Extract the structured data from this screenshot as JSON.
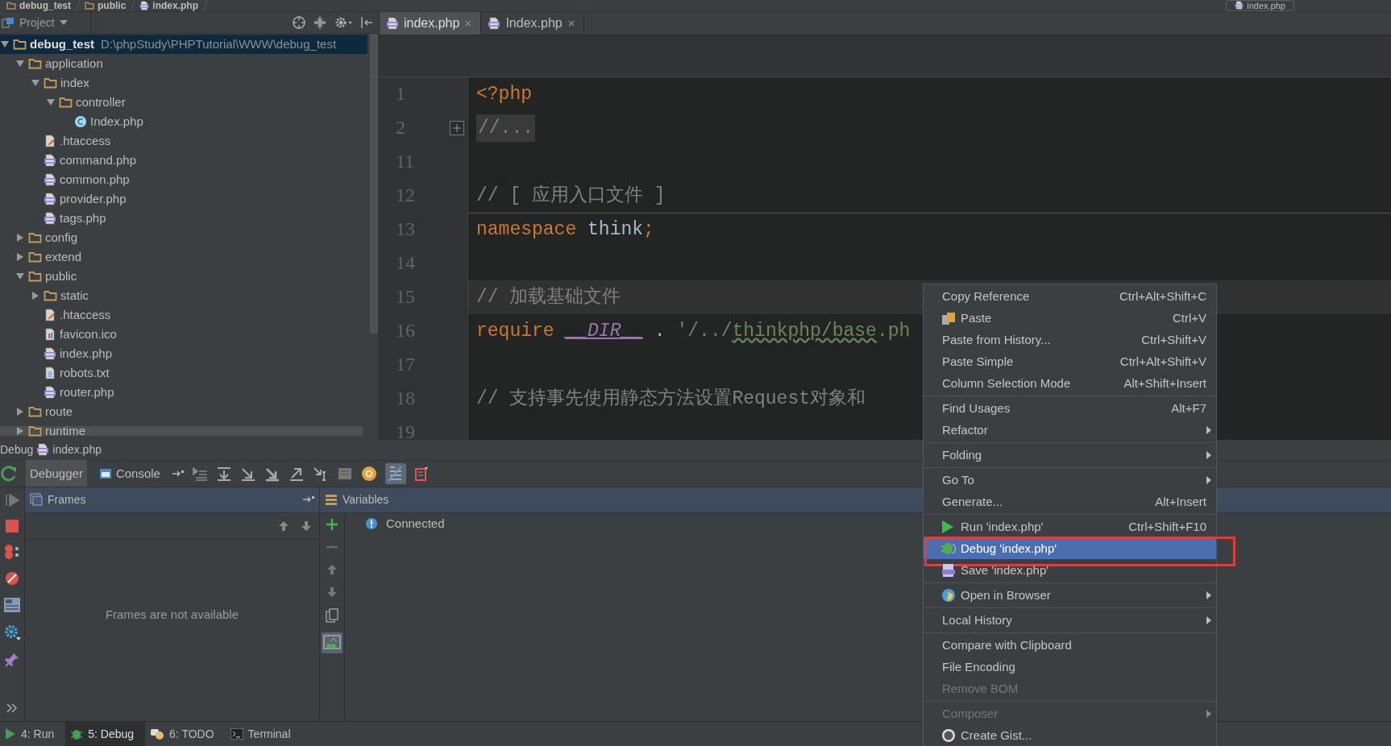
{
  "breadcrumb": [
    {
      "label": "debug_test",
      "kind": "folder"
    },
    {
      "label": "public",
      "kind": "folder"
    },
    {
      "label": "index.php",
      "kind": "php"
    }
  ],
  "run_config": "index.php",
  "project": {
    "title": "Project",
    "tree": [
      {
        "name": "debug_test",
        "path": "D:\\phpStudy\\PHPTutorial\\WWW\\debug_test",
        "kind": "folder",
        "expanded": true,
        "selected": true,
        "children": [
          {
            "name": "application",
            "kind": "folder",
            "expanded": true,
            "selected": false,
            "children": [
              {
                "name": "index",
                "kind": "folder",
                "expanded": true,
                "selected": false,
                "children": [
                  {
                    "name": "controller",
                    "kind": "folder",
                    "expanded": true,
                    "selected": false,
                    "children": [
                      {
                        "name": "Index.php",
                        "kind": "class",
                        "selected": false
                      }
                    ]
                  }
                ]
              },
              {
                "name": ".htaccess",
                "kind": "htaccess",
                "selected": false
              },
              {
                "name": "command.php",
                "kind": "php",
                "selected": false
              },
              {
                "name": "common.php",
                "kind": "php",
                "selected": false
              },
              {
                "name": "provider.php",
                "kind": "php",
                "selected": false
              },
              {
                "name": "tags.php",
                "kind": "php",
                "selected": false
              }
            ]
          },
          {
            "name": "config",
            "kind": "folder",
            "expanded": false,
            "selected": false
          },
          {
            "name": "extend",
            "kind": "folder",
            "expanded": false,
            "selected": false
          },
          {
            "name": "public",
            "kind": "folder",
            "expanded": true,
            "selected": false,
            "children": [
              {
                "name": "static",
                "kind": "folder",
                "expanded": false,
                "selected": false
              },
              {
                "name": ".htaccess",
                "kind": "htaccess",
                "selected": false
              },
              {
                "name": "favicon.ico",
                "kind": "ico",
                "selected": false
              },
              {
                "name": "index.php",
                "kind": "php",
                "selected": false
              },
              {
                "name": "robots.txt",
                "kind": "txt",
                "selected": false
              },
              {
                "name": "router.php",
                "kind": "php",
                "selected": false
              }
            ]
          },
          {
            "name": "route",
            "kind": "folder",
            "expanded": false,
            "selected": false
          },
          {
            "name": "runtime",
            "kind": "folder",
            "expanded": false,
            "selected": false
          }
        ]
      }
    ]
  },
  "editor": {
    "tabs": [
      {
        "label": "index.php",
        "selected": true
      },
      {
        "label": "Index.php",
        "selected": false
      }
    ],
    "lines": [
      {
        "number": "1",
        "current": false,
        "folded": false,
        "separator_above": false,
        "tokens": [
          {
            "text": "<?php",
            "kind": "keyword"
          }
        ]
      },
      {
        "number": "2",
        "current": false,
        "folded": true,
        "separator_above": false,
        "tokens": [
          {
            "text": "//...",
            "kind": "folded"
          }
        ]
      },
      {
        "number": "11",
        "current": false,
        "folded": false,
        "separator_above": false
      },
      {
        "number": "12",
        "current": false,
        "folded": false,
        "separator_above": false,
        "tokens": [
          {
            "text": "// [ 应用入口文件 ]",
            "kind": "comment"
          }
        ]
      },
      {
        "number": "13",
        "current": false,
        "folded": false,
        "separator_above": true,
        "tokens": [
          {
            "text": "namespace",
            "kind": "keyword"
          },
          {
            "text": " think",
            "kind": "plain"
          },
          {
            "text": ";",
            "kind": "keyword"
          }
        ]
      },
      {
        "number": "14",
        "current": false,
        "folded": false,
        "separator_above": false
      },
      {
        "number": "15",
        "current": true,
        "folded": false,
        "separator_above": false,
        "tokens": [
          {
            "text": "// 加载基础文件",
            "kind": "comment"
          }
        ]
      },
      {
        "number": "16",
        "current": false,
        "folded": false,
        "separator_above": false,
        "tokens": [
          {
            "text": "require ",
            "kind": "keyword"
          },
          {
            "text": "__DIR__",
            "kind": "constant"
          },
          {
            "text": " . ",
            "kind": "plain"
          },
          {
            "text": "'/../",
            "kind": "string"
          },
          {
            "text": "thinkphp/base",
            "kind": "typo"
          },
          {
            "text": ".ph",
            "kind": "string"
          }
        ]
      },
      {
        "number": "17",
        "current": false,
        "folded": false,
        "separator_above": false
      },
      {
        "number": "18",
        "current": false,
        "folded": false,
        "separator_above": false,
        "tokens": [
          {
            "text": "// 支持事先使用静态方法设置Request对象和",
            "kind": "comment"
          }
        ]
      },
      {
        "number": "19",
        "current": false,
        "folded": false,
        "separator_above": false
      }
    ]
  },
  "debug": {
    "title": "Debug",
    "file": "index.php",
    "tabs": [
      {
        "label": "Debugger",
        "selected": true
      },
      {
        "label": "Console",
        "selected": false
      }
    ],
    "show_values_on": true,
    "frames": {
      "title": "Frames",
      "empty_text": "Frames are not available"
    },
    "variables": {
      "title": "Variables",
      "inline_watches_on": true,
      "items": [
        {
          "text": "Connected",
          "kind": "info"
        }
      ]
    }
  },
  "tool_windows": [
    {
      "label": "4: Run",
      "kind": "run",
      "selected": false
    },
    {
      "label": "5: Debug",
      "kind": "debug",
      "selected": true
    },
    {
      "label": "6: TODO",
      "kind": "todo",
      "selected": false
    },
    {
      "label": "Terminal",
      "kind": "terminal",
      "selected": false
    }
  ],
  "context_menu": {
    "items": [
      {
        "kind": "plain",
        "label": "Copy Reference",
        "shortcut": "Ctrl+Alt+Shift+C",
        "submenu": false,
        "disabled": false,
        "selected": false,
        "annotated": false
      },
      {
        "kind": "paste",
        "label": "Paste",
        "shortcut": "Ctrl+V",
        "submenu": false,
        "disabled": false,
        "selected": false,
        "annotated": false
      },
      {
        "kind": "plain",
        "label": "Paste from History...",
        "shortcut": "Ctrl+Shift+V",
        "submenu": false,
        "disabled": false,
        "selected": false,
        "annotated": false
      },
      {
        "kind": "plain",
        "label": "Paste Simple",
        "shortcut": "Ctrl+Alt+Shift+V",
        "submenu": false,
        "disabled": false,
        "selected": false,
        "annotated": false
      },
      {
        "kind": "plain",
        "label": "Column Selection Mode",
        "shortcut": "Alt+Shift+Insert",
        "submenu": false,
        "disabled": false,
        "selected": false,
        "annotated": false
      },
      {
        "kind": "separator"
      },
      {
        "kind": "plain",
        "label": "Find Usages",
        "shortcut": "Alt+F7",
        "submenu": false,
        "disabled": false,
        "selected": false,
        "annotated": false
      },
      {
        "kind": "plain",
        "label": "Refactor",
        "submenu": true,
        "disabled": false,
        "selected": false,
        "annotated": false
      },
      {
        "kind": "separator"
      },
      {
        "kind": "plain",
        "label": "Folding",
        "submenu": true,
        "disabled": false,
        "selected": false,
        "annotated": false
      },
      {
        "kind": "separator"
      },
      {
        "kind": "plain",
        "label": "Go To",
        "submenu": true,
        "disabled": false,
        "selected": false,
        "annotated": false
      },
      {
        "kind": "plain",
        "label": "Generate...",
        "shortcut": "Alt+Insert",
        "submenu": false,
        "disabled": false,
        "selected": false,
        "annotated": false
      },
      {
        "kind": "separator"
      },
      {
        "kind": "run",
        "label": "Run 'index.php'",
        "shortcut": "Ctrl+Shift+F10",
        "submenu": false,
        "disabled": false,
        "selected": false,
        "annotated": false
      },
      {
        "kind": "debug",
        "label": "Debug 'index.php'",
        "submenu": false,
        "disabled": false,
        "selected": true,
        "annotated": true
      },
      {
        "kind": "save",
        "label": "Save 'index.php'",
        "submenu": false,
        "disabled": false,
        "selected": false,
        "annotated": false
      },
      {
        "kind": "separator"
      },
      {
        "kind": "browser",
        "label": "Open in Browser",
        "submenu": true,
        "disabled": false,
        "selected": false,
        "annotated": false
      },
      {
        "kind": "separator"
      },
      {
        "kind": "plain",
        "label": "Local History",
        "submenu": true,
        "disabled": false,
        "selected": false,
        "annotated": false
      },
      {
        "kind": "separator"
      },
      {
        "kind": "plain",
        "label": "Compare with Clipboard",
        "submenu": false,
        "disabled": false,
        "selected": false,
        "annotated": false
      },
      {
        "kind": "plain",
        "label": "File Encoding",
        "submenu": false,
        "disabled": false,
        "selected": false,
        "annotated": false
      },
      {
        "kind": "plain",
        "label": "Remove BOM",
        "submenu": false,
        "disabled": true,
        "selected": false,
        "annotated": false
      },
      {
        "kind": "separator"
      },
      {
        "kind": "plain",
        "label": "Composer",
        "submenu": true,
        "disabled": true,
        "selected": false,
        "annotated": false
      },
      {
        "kind": "gist",
        "label": "Create Gist...",
        "submenu": false,
        "disabled": false,
        "selected": false,
        "annotated": false
      }
    ]
  }
}
